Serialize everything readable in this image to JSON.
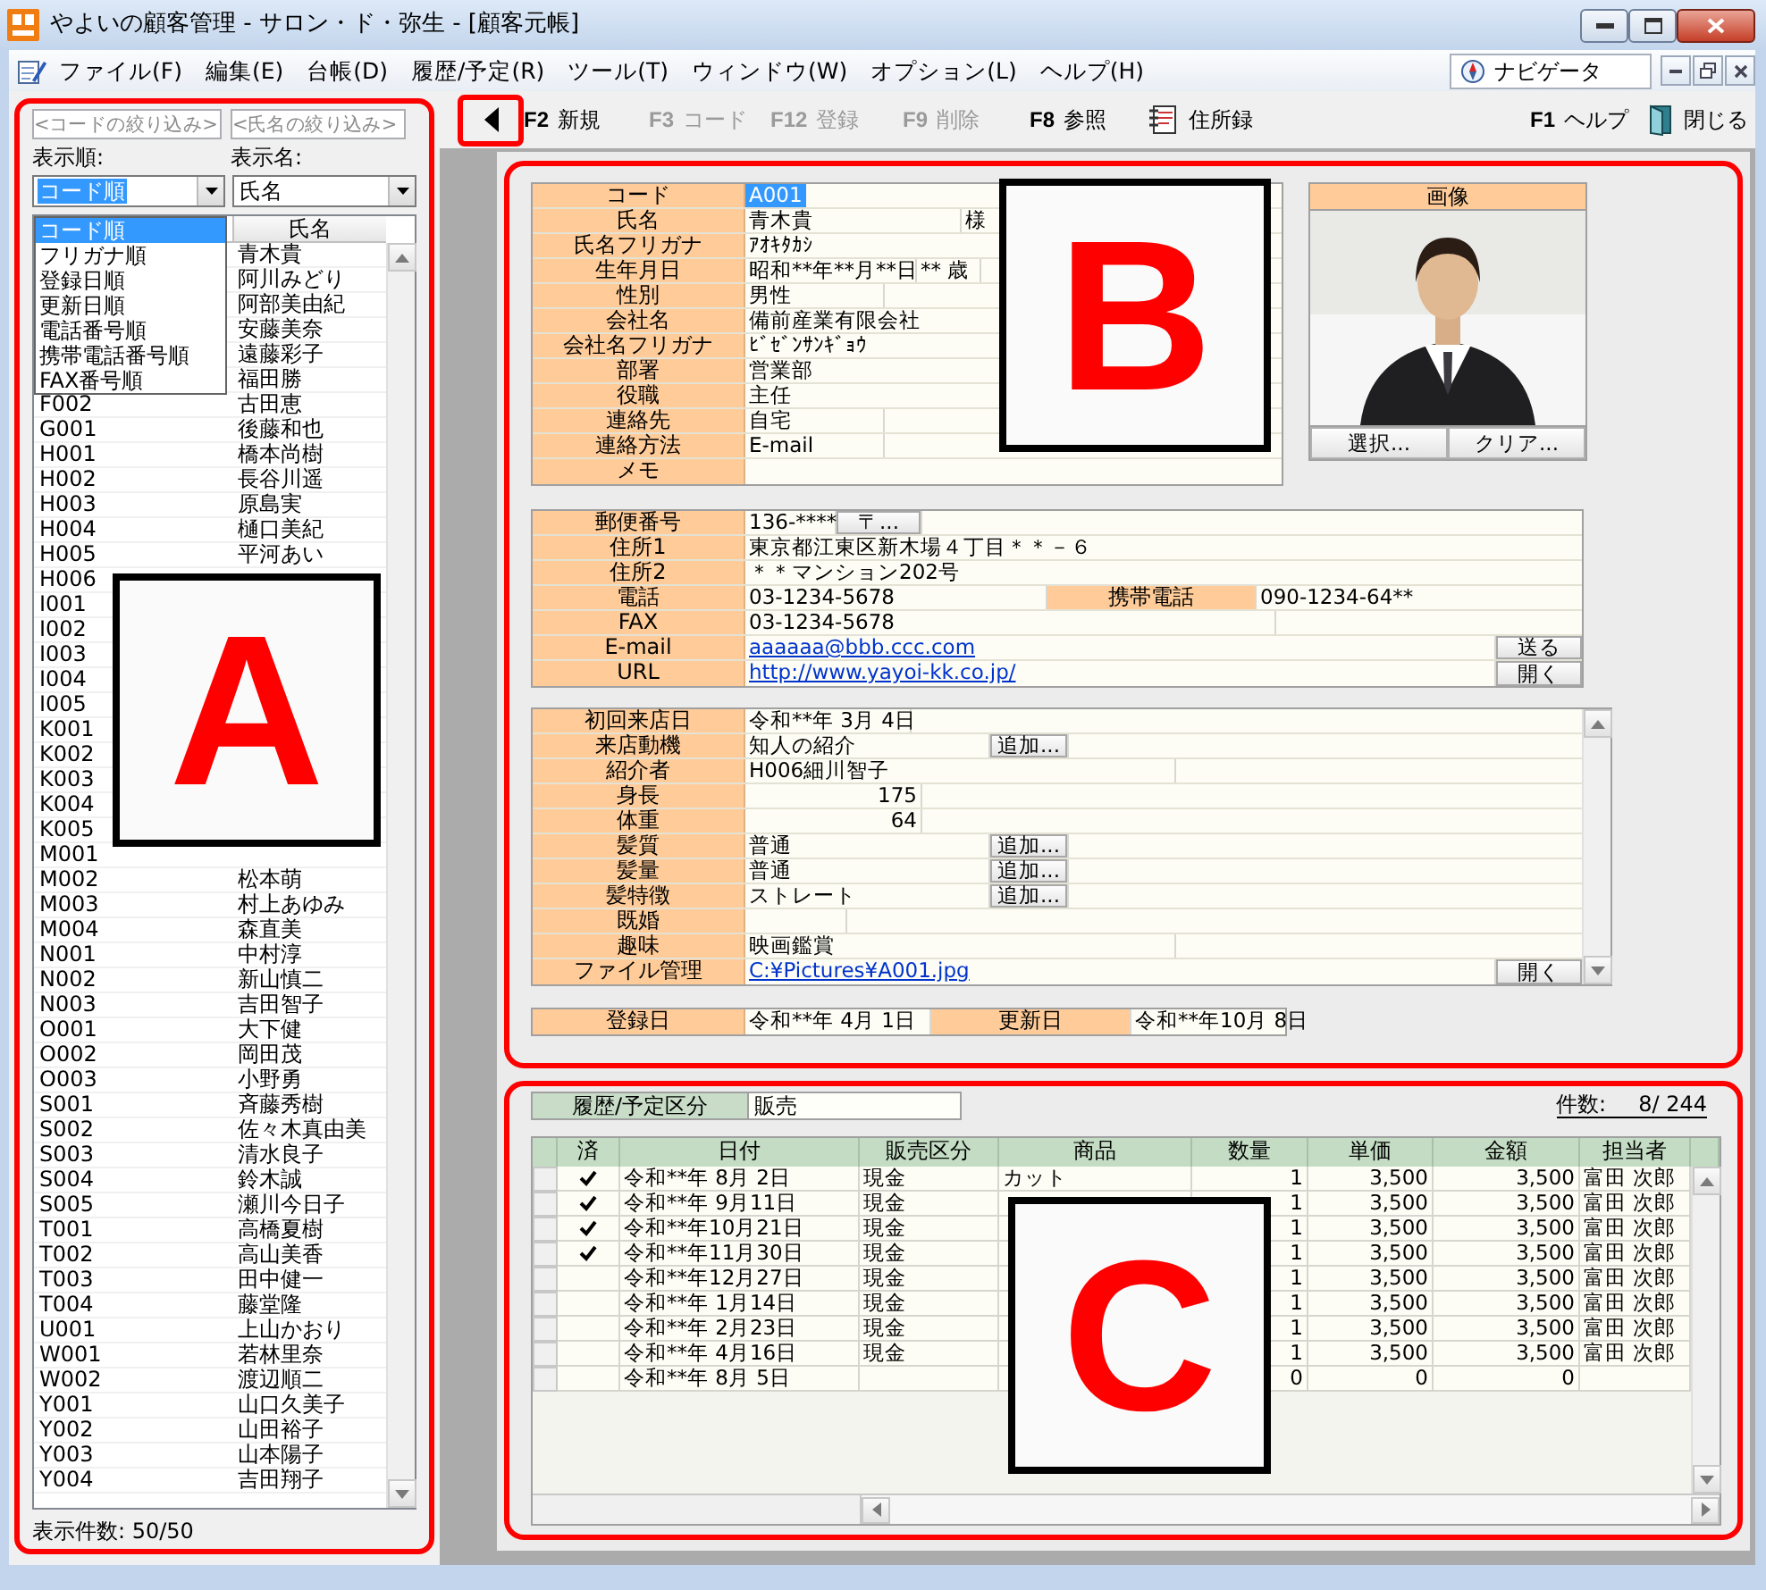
{
  "window": {
    "title": "やよいの顧客管理 - サロン・ド・弥生 - [顧客元帳]"
  },
  "menu": [
    "ファイル(F)",
    "編集(E)",
    "台帳(D)",
    "履歴/予定(R)",
    "ツール(T)",
    "ウィンドウ(W)",
    "オプション(L)",
    "ヘルプ(H)"
  ],
  "navigator": {
    "label": "ナビゲータ"
  },
  "sidebar": {
    "callout": "A",
    "code_filter": {
      "placeholder": "<コードの絞り込み>"
    },
    "name_filter": {
      "placeholder": "<氏名の絞り込み>"
    },
    "sort": {
      "label": "表示順:",
      "value": "コード順",
      "focused": true,
      "expanded": true,
      "options": [
        {
          "label": "コード順",
          "selected": true
        },
        {
          "label": "フリガナ順",
          "selected": false
        },
        {
          "label": "登録日順",
          "selected": false
        },
        {
          "label": "更新日順",
          "selected": false
        },
        {
          "label": "電話番号順",
          "selected": false
        },
        {
          "label": "携帯電話番号順",
          "selected": false
        },
        {
          "label": "FAX番号順",
          "selected": false
        }
      ]
    },
    "display": {
      "label": "表示名:",
      "value": "氏名",
      "focused": false
    },
    "name_header": "氏名",
    "rows": [
      {
        "name": "青木貴"
      },
      {
        "name": "阿川みどり"
      },
      {
        "name": "阿部美由紀"
      },
      {
        "name": "安藤美奈"
      },
      {
        "name": "遠藤彩子"
      },
      {
        "name": "福田勝"
      },
      {
        "code": "F002",
        "name": "古田恵"
      },
      {
        "code": "G001",
        "name": "後藤和也"
      },
      {
        "code": "H001",
        "name": "橋本尚樹"
      },
      {
        "code": "H002",
        "name": "長谷川遥"
      },
      {
        "code": "H003",
        "name": "原島実"
      },
      {
        "code": "H004",
        "name": "樋口美紀"
      },
      {
        "code": "H005",
        "name": "平河あい"
      },
      {
        "code": "H006"
      },
      {
        "code": "I001"
      },
      {
        "code": "I002"
      },
      {
        "code": "I003"
      },
      {
        "code": "I004"
      },
      {
        "code": "I005"
      },
      {
        "code": "K001"
      },
      {
        "code": "K002"
      },
      {
        "code": "K003"
      },
      {
        "code": "K004"
      },
      {
        "code": "K005"
      },
      {
        "code": "M001"
      },
      {
        "code": "M002",
        "name": "松本萌"
      },
      {
        "code": "M003",
        "name": "村上あゆみ"
      },
      {
        "code": "M004",
        "name": "森直美"
      },
      {
        "code": "N001",
        "name": "中村淳"
      },
      {
        "code": "N002",
        "name": "新山慎二"
      },
      {
        "code": "N003",
        "name": "吉田智子"
      },
      {
        "code": "O001",
        "name": "大下健"
      },
      {
        "code": "O002",
        "name": "岡田茂"
      },
      {
        "code": "O003",
        "name": "小野勇"
      },
      {
        "code": "S001",
        "name": "斉藤秀樹"
      },
      {
        "code": "S002",
        "name": "佐々木真由美"
      },
      {
        "code": "S003",
        "name": "清水良子"
      },
      {
        "code": "S004",
        "name": "鈴木誠"
      },
      {
        "code": "S005",
        "name": "瀬川今日子"
      },
      {
        "code": "T001",
        "name": "高橋夏樹"
      },
      {
        "code": "T002",
        "name": "高山美香"
      },
      {
        "code": "T003",
        "name": "田中健一"
      },
      {
        "code": "T004",
        "name": "藤堂隆"
      },
      {
        "code": "U001",
        "name": "上山かおり"
      },
      {
        "code": "W001",
        "name": "若林里奈"
      },
      {
        "code": "W002",
        "name": "渡辺順二"
      },
      {
        "code": "Y001",
        "name": "山口久美子"
      },
      {
        "code": "Y002",
        "name": "山田裕子"
      },
      {
        "code": "Y003",
        "name": "山本陽子"
      },
      {
        "code": "Y004",
        "name": "吉田翔子"
      }
    ],
    "count": "表示件数: 50/50"
  },
  "toolbar": {
    "back": {
      "framed": true
    },
    "items": [
      {
        "kind": "function",
        "key": "F2",
        "label": "新規",
        "disabled": false
      },
      {
        "kind": "function",
        "key": "F3",
        "label": "コード",
        "disabled": true
      },
      {
        "kind": "function",
        "key": "F12",
        "label": "登録",
        "disabled": true
      },
      {
        "kind": "function",
        "key": "F9",
        "label": "削除",
        "disabled": true
      },
      {
        "kind": "function",
        "key": "F8",
        "label": "参照",
        "disabled": false
      },
      {
        "kind": "contacts",
        "label": "住所録",
        "disabled": false
      }
    ],
    "right": [
      {
        "kind": "function",
        "key": "F1",
        "label": "ヘルプ",
        "disabled": false
      },
      {
        "kind": "exit",
        "label": "閉じる",
        "disabled": false
      }
    ]
  },
  "detail": {
    "callout": "B",
    "basic": [
      {
        "label": "コード",
        "cells": [
          {
            "kind": "text",
            "text": "A001",
            "focused": true
          }
        ]
      },
      {
        "label": "氏名",
        "cells": [
          {
            "kind": "text",
            "text": "青木貴"
          },
          {
            "kind": "text",
            "text": "様"
          }
        ]
      },
      {
        "label": "氏名フリガナ",
        "cells": [
          {
            "kind": "text",
            "text": "ｱｵｷﾀｶｼ"
          }
        ]
      },
      {
        "label": "生年月日",
        "cells": [
          {
            "kind": "text",
            "text": "昭和**年**月**日"
          },
          {
            "kind": "text",
            "text": "** 歳"
          }
        ]
      },
      {
        "label": "性別",
        "cells": [
          {
            "kind": "text",
            "text": "男性"
          }
        ]
      },
      {
        "label": "会社名",
        "cells": [
          {
            "kind": "text",
            "text": "備前産業有限会社"
          }
        ]
      },
      {
        "label": "会社名フリガナ",
        "cells": [
          {
            "kind": "text",
            "text": "ﾋﾞｾﾞﾝｻﾝｷﾞｮｳ"
          }
        ]
      },
      {
        "label": "部署",
        "cells": [
          {
            "kind": "text",
            "text": "営業部"
          }
        ]
      },
      {
        "label": "役職",
        "cells": [
          {
            "kind": "text",
            "text": "主任"
          }
        ]
      },
      {
        "label": "連絡先",
        "cells": [
          {
            "kind": "text",
            "text": "自宅"
          }
        ]
      },
      {
        "label": "連絡方法",
        "cells": [
          {
            "kind": "text",
            "text": "E-mail"
          }
        ]
      },
      {
        "label": "メモ"
      }
    ],
    "photo": {
      "title": "画像",
      "kind": "picture",
      "buttons": [
        "選択...",
        "クリア..."
      ]
    },
    "address": [
      {
        "label": "郵便番号",
        "cells": [
          {
            "kind": "text",
            "text": "136-****"
          },
          {
            "kind": "button",
            "text": "〒..."
          }
        ]
      },
      {
        "label": "住所1",
        "cells": [
          {
            "kind": "text",
            "text": "東京都江東区新木場４丁目＊＊－６"
          }
        ]
      },
      {
        "label": "住所2",
        "cells": [
          {
            "kind": "text",
            "text": "＊＊マンション202号"
          }
        ]
      },
      {
        "label": "電話",
        "cells": [
          {
            "kind": "text",
            "text": "03-1234-5678"
          },
          {
            "kind": "label",
            "text": "携帯電話"
          },
          {
            "kind": "text",
            "text": "090-1234-64**"
          }
        ]
      },
      {
        "label": "FAX",
        "cells": [
          {
            "kind": "text",
            "text": "03-1234-5678"
          }
        ]
      },
      {
        "label": "E-mail",
        "cells": [
          {
            "kind": "link",
            "text": "aaaaaa@bbb.ccc.com"
          },
          {
            "kind": "button",
            "text": "送る"
          }
        ]
      },
      {
        "label": "URL",
        "cells": [
          {
            "kind": "link",
            "text": "http://www.yayoi-kk.co.jp/"
          },
          {
            "kind": "button",
            "text": "開く"
          }
        ]
      }
    ],
    "profile": [
      {
        "label": "初回来店日",
        "cells": [
          {
            "kind": "text",
            "text": "令和**年 3月 4日"
          }
        ]
      },
      {
        "label": "来店動機",
        "cells": [
          {
            "kind": "text",
            "text": "知人の紹介"
          },
          {
            "kind": "button",
            "text": "追加..."
          }
        ]
      },
      {
        "label": "紹介者",
        "cells": [
          {
            "kind": "text",
            "text": "H006細川智子"
          }
        ]
      },
      {
        "label": "身長",
        "cells": [
          {
            "kind": "number",
            "text": "175"
          }
        ]
      },
      {
        "label": "体重",
        "cells": [
          {
            "kind": "number",
            "text": "64"
          }
        ]
      },
      {
        "label": "髪質",
        "cells": [
          {
            "kind": "text",
            "text": "普通"
          },
          {
            "kind": "button",
            "text": "追加..."
          }
        ]
      },
      {
        "label": "髪量",
        "cells": [
          {
            "kind": "text",
            "text": "普通"
          },
          {
            "kind": "button",
            "text": "追加..."
          }
        ]
      },
      {
        "label": "髪特徴",
        "cells": [
          {
            "kind": "text",
            "text": "ストレート"
          },
          {
            "kind": "button",
            "text": "追加..."
          }
        ]
      },
      {
        "label": "既婚"
      },
      {
        "label": "趣味",
        "cells": [
          {
            "kind": "text",
            "text": "映画鑑賞"
          }
        ]
      },
      {
        "label": "ファイル管理",
        "cells": [
          {
            "kind": "link",
            "text": "C:¥Pictures¥A001.jpg"
          },
          {
            "kind": "button",
            "text": "開く"
          }
        ]
      }
    ],
    "dates": [
      {
        "label": "登録日",
        "cells": [
          {
            "kind": "text",
            "text": "令和**年 4月 1日"
          },
          {
            "kind": "label",
            "text": "更新日"
          },
          {
            "kind": "text",
            "text": "令和**年10月 8日"
          }
        ]
      }
    ]
  },
  "history": {
    "callout": "C",
    "filter_label": "履歴/予定区分",
    "filter_value": "販売",
    "count_label": "件数:",
    "count": "8/ 244",
    "columns": [
      "済",
      "日付",
      "販売区分",
      "商品",
      "数量",
      "単価",
      "金額",
      "担当者"
    ],
    "rows": [
      {
        "done": true,
        "date": "令和**年 8月 2日",
        "type": "現金",
        "item": "カット",
        "qty": "1",
        "price": "3,500",
        "amount": "3,500",
        "staff": "富田 次郎"
      },
      {
        "done": true,
        "date": "令和**年 9月11日",
        "type": "現金",
        "qty": "1",
        "price": "3,500",
        "amount": "3,500",
        "staff": "富田 次郎"
      },
      {
        "done": true,
        "date": "令和**年10月21日",
        "type": "現金",
        "qty": "1",
        "price": "3,500",
        "amount": "3,500",
        "staff": "富田 次郎"
      },
      {
        "done": true,
        "date": "令和**年11月30日",
        "type": "現金",
        "qty": "1",
        "price": "3,500",
        "amount": "3,500",
        "staff": "富田 次郎"
      },
      {
        "done": false,
        "date": "令和**年12月27日",
        "type": "現金",
        "qty": "1",
        "price": "3,500",
        "amount": "3,500",
        "staff": "富田 次郎"
      },
      {
        "done": false,
        "date": "令和**年 1月14日",
        "type": "現金",
        "qty": "1",
        "price": "3,500",
        "amount": "3,500",
        "staff": "富田 次郎"
      },
      {
        "done": false,
        "date": "令和**年 2月23日",
        "type": "現金",
        "qty": "1",
        "price": "3,500",
        "amount": "3,500",
        "staff": "富田 次郎"
      },
      {
        "done": false,
        "date": "令和**年 4月16日",
        "type": "現金",
        "qty": "1",
        "price": "3,500",
        "amount": "3,500",
        "staff": "富田 次郎"
      },
      {
        "done": false,
        "date": "令和**年 8月 5日",
        "qty": "0",
        "price": "0",
        "amount": "0"
      }
    ]
  }
}
